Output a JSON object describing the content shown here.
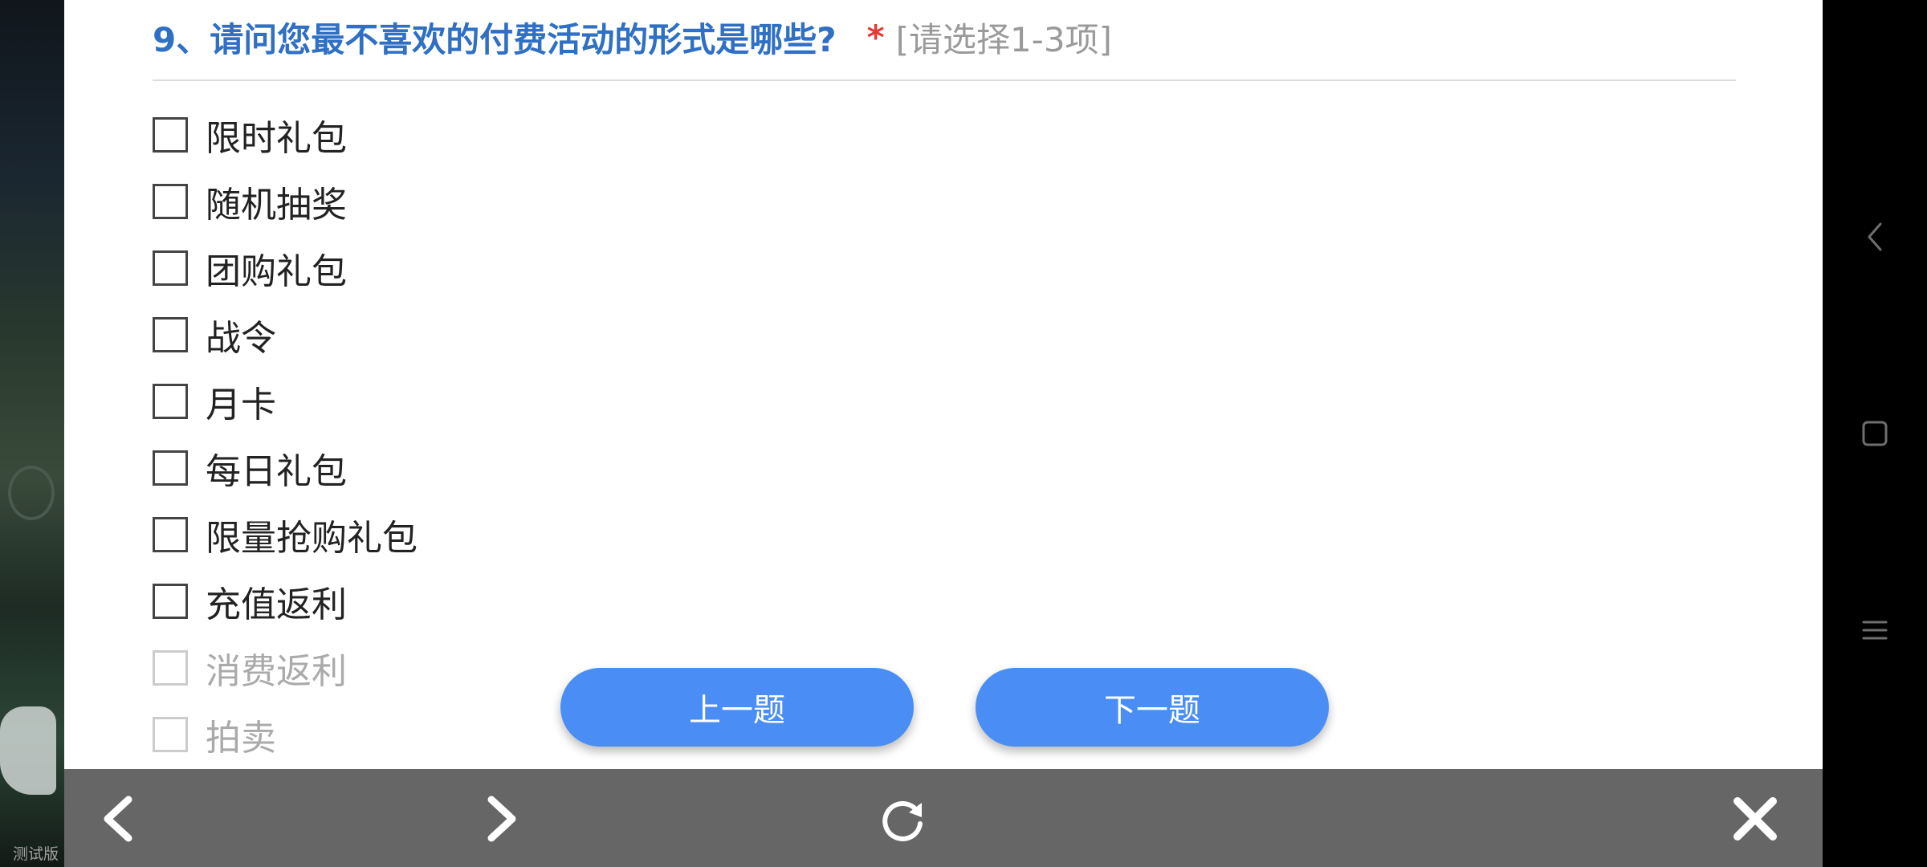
{
  "question": {
    "title": "9、请问您最不喜欢的付费活动的形式是哪些?",
    "required_mark": "*",
    "hint": "[请选择1-3项]"
  },
  "options": [
    {
      "label": "限时礼包",
      "checked": false
    },
    {
      "label": "随机抽奖",
      "checked": false
    },
    {
      "label": "团购礼包",
      "checked": false
    },
    {
      "label": "战令",
      "checked": false
    },
    {
      "label": "月卡",
      "checked": false
    },
    {
      "label": "每日礼包",
      "checked": false
    },
    {
      "label": "限量抢购礼包",
      "checked": false
    },
    {
      "label": "充值返利",
      "checked": false
    },
    {
      "label": "消费返利",
      "checked": false
    },
    {
      "label": "拍卖",
      "checked": false
    }
  ],
  "buttons": {
    "prev": "上一题",
    "next": "下一题"
  },
  "toolbar": {
    "back_icon": "chevron-left-icon",
    "forward_icon": "chevron-right-icon",
    "refresh_icon": "refresh-icon",
    "close_icon": "close-icon"
  },
  "watermark": "测试版",
  "colors": {
    "question_title": "#2f6fc4",
    "required": "#e53935",
    "button": "#4a8ef5",
    "toolbar": "#666666"
  }
}
